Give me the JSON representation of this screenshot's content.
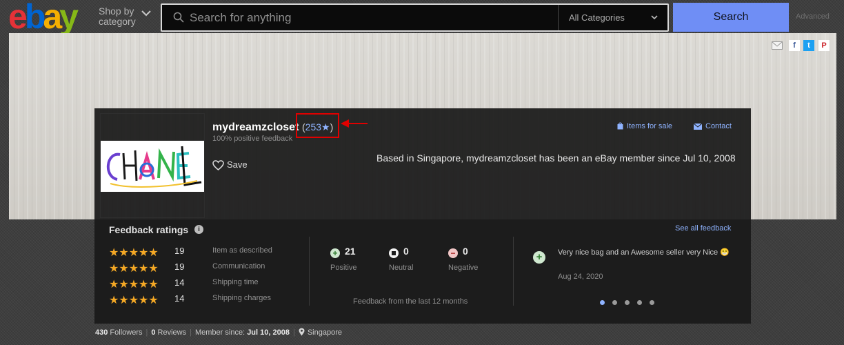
{
  "header": {
    "logo_letters": [
      "e",
      "b",
      "a",
      "y"
    ],
    "logo_colors": [
      "#e53238",
      "#0064d2",
      "#f5af02",
      "#86b817"
    ],
    "shop_by_line1": "Shop by",
    "shop_by_line2": "category",
    "search_placeholder": "Search for anything",
    "category_label": "All Categories",
    "search_button": "Search",
    "advanced_link": "Advanced"
  },
  "share": {
    "facebook": "f",
    "twitter": "t",
    "pinterest": "P"
  },
  "seller": {
    "name": "mydreamzcloset",
    "score_open": "(",
    "score_value": "253★",
    "score_close": ")",
    "positive_feedback": "100% positive feedback",
    "save_label": "Save",
    "items_for_sale": "Items for sale",
    "contact": "Contact",
    "based_in": "Based in Singapore, mydreamzcloset has been an eBay member since Jul 10, 2008",
    "logo_text": "CHANEL"
  },
  "feedback": {
    "title": "Feedback ratings",
    "info": "i",
    "see_all": "See all feedback",
    "stars": "★★★★★",
    "ratings": [
      {
        "count": "19",
        "label": "Item as described"
      },
      {
        "count": "19",
        "label": "Communication"
      },
      {
        "count": "14",
        "label": "Shipping time"
      },
      {
        "count": "14",
        "label": "Shipping charges"
      }
    ],
    "positive": {
      "count": "21",
      "label": "Positive"
    },
    "neutral": {
      "count": "0",
      "label": "Neutral"
    },
    "negative": {
      "count": "0",
      "label": "Negative"
    },
    "period": "Feedback from the last 12 months",
    "comment": {
      "text": "Very nice bag and an Awesome seller very Nice 😁",
      "date": "Aug 24, 2020"
    }
  },
  "stats": {
    "followers_count": "430",
    "followers_label": "Followers",
    "reviews_count": "0",
    "reviews_label": "Reviews",
    "member_label": "Member since:",
    "member_date": "Jul 10, 2008",
    "location": "Singapore"
  }
}
